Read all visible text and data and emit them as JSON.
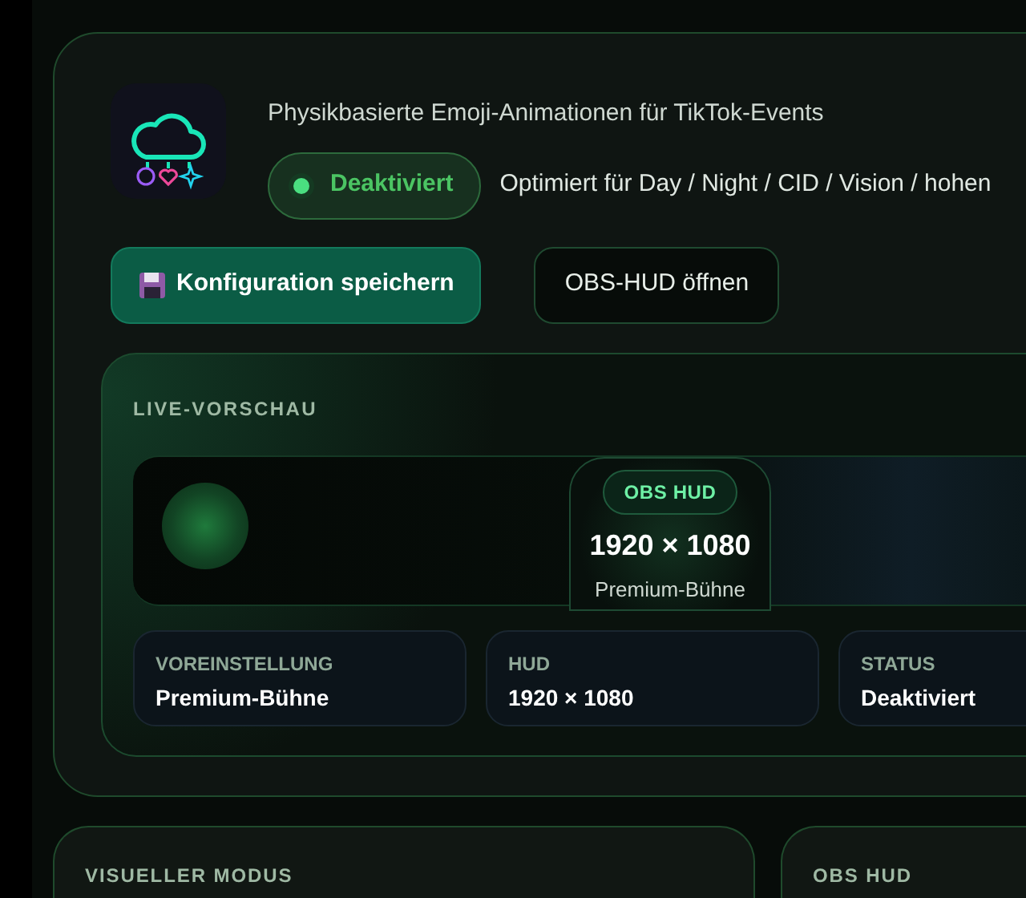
{
  "header": {
    "subtitle": "Physikbasierte Emoji-Animationen für TikTok-Events",
    "status": "Deaktiviert",
    "note": "Optimiert für Day / Night / CID / Vision / hohen"
  },
  "buttons": [
    {
      "label": "Konfiguration speichern",
      "kind": "primary"
    },
    {
      "label": "OBS-HUD öffnen",
      "kind": "secondary"
    }
  ],
  "preview": {
    "title": "LIVE-VORSCHAU",
    "badge": "OBS HUD",
    "resolution": "1920 × 1080",
    "preset": "Premium-Bühne",
    "stats": [
      {
        "label": "VOREINSTELLUNG",
        "value": "Premium-Bühne"
      },
      {
        "label": "HUD",
        "value": "1920 × 1080"
      },
      {
        "label": "STATUS",
        "value": "Deaktiviert"
      }
    ]
  },
  "panels": [
    {
      "title": "VISUELLER MODUS"
    },
    {
      "title": "OBS HUD"
    }
  ]
}
